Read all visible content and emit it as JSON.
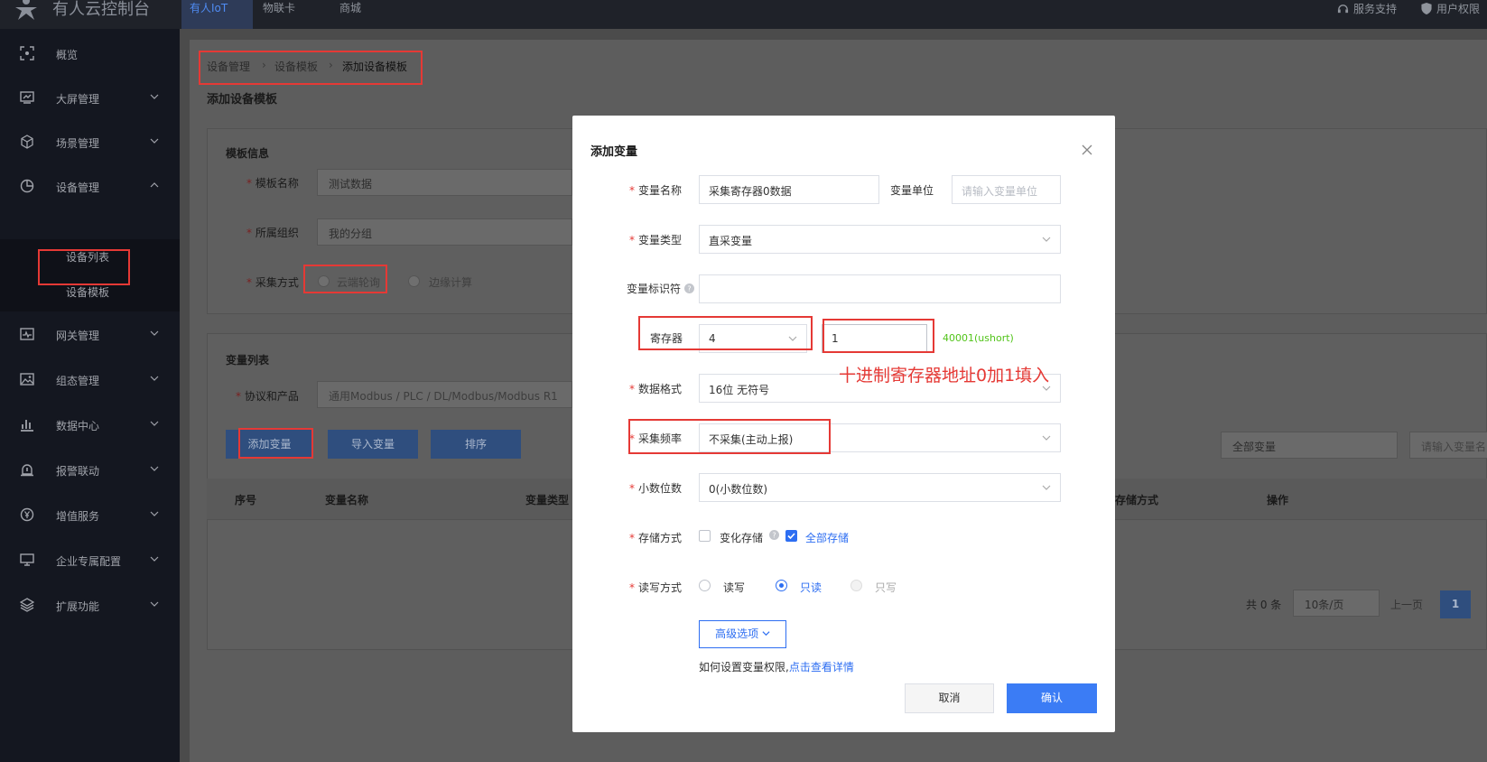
{
  "topbar": {
    "brand": "有人云控制台",
    "tabs": [
      "有人IoT",
      "物联卡",
      "商城"
    ],
    "support": "服务支持",
    "user": "用户权限"
  },
  "sidebar": {
    "items": [
      {
        "label": "概览",
        "icon": "overview-icon"
      },
      {
        "label": "大屏管理",
        "icon": "screen-icon"
      },
      {
        "label": "场景管理",
        "icon": "cube-icon"
      },
      {
        "label": "设备管理",
        "icon": "pie-icon"
      },
      {
        "label": "网关管理",
        "icon": "gateway-icon"
      },
      {
        "label": "组态管理",
        "icon": "image-icon"
      },
      {
        "label": "数据中心",
        "icon": "bar-chart-icon"
      },
      {
        "label": "报警联动",
        "icon": "alarm-icon"
      },
      {
        "label": "增值服务",
        "icon": "yen-icon"
      },
      {
        "label": "企业专属配置",
        "icon": "monitor-icon"
      },
      {
        "label": "扩展功能",
        "icon": "layers-icon"
      }
    ],
    "sub": [
      "设备列表",
      "设备模板"
    ]
  },
  "breadcrumb": [
    "设备管理",
    "设备模板",
    "添加设备模板"
  ],
  "page_title": "添加设备模板",
  "template_info": {
    "title": "模板信息",
    "name_label": "模板名称",
    "name_value": "测试数据",
    "group_label": "所属组织",
    "group_value": "我的分组",
    "collect_label": "采集方式",
    "collect_opt1": "云端轮询",
    "collect_opt2": "边缘计算"
  },
  "var_list": {
    "title": "变量列表",
    "protocol_label": "协议和产品",
    "protocol_value": "通用Modbus / PLC / DL/Modbus/Modbus R1",
    "btn_add": "添加变量",
    "btn_import": "导入变量",
    "btn_sort": "排序",
    "filter_all": "全部变量",
    "filter_ph": "请输入变量名",
    "headers": [
      "序号",
      "变量名称",
      "变量类型",
      "存储方式",
      "操作"
    ],
    "pager": {
      "total": "共 0 条",
      "per_page": "10条/页",
      "prev": "上一页",
      "current": "1"
    }
  },
  "modal": {
    "title": "添加变量",
    "name_label": "变量名称",
    "name_value": "采集寄存器0数据",
    "unit_label": "变量单位",
    "unit_ph": "请输入变量单位",
    "type_label": "变量类型",
    "type_value": "直采变量",
    "id_label": "变量标识符",
    "reg_label": "寄存器",
    "reg_value": "4",
    "reg_addr": "1",
    "reg_hint": "40001(ushort)",
    "annotation": "十进制寄存器地址0加1填入",
    "format_label": "数据格式",
    "format_value": "16位 无符号",
    "freq_label": "采集频率",
    "freq_value": "不采集(主动上报)",
    "decimal_label": "小数位数",
    "decimal_value": "0(小数位数)",
    "store_label": "存储方式",
    "store_opt1": "变化存储",
    "store_opt2": "全部存储",
    "rw_label": "读写方式",
    "rw_opt1": "读写",
    "rw_opt2": "只读",
    "rw_opt3": "只写",
    "advanced": "高级选项",
    "help_text": "如何设置变量权限,",
    "help_link": "点击查看详情",
    "cancel": "取消",
    "confirm": "确认"
  },
  "colors": {
    "accent": "#2d6ef2",
    "annotation": "#e53935",
    "hint": "#52c41a"
  }
}
